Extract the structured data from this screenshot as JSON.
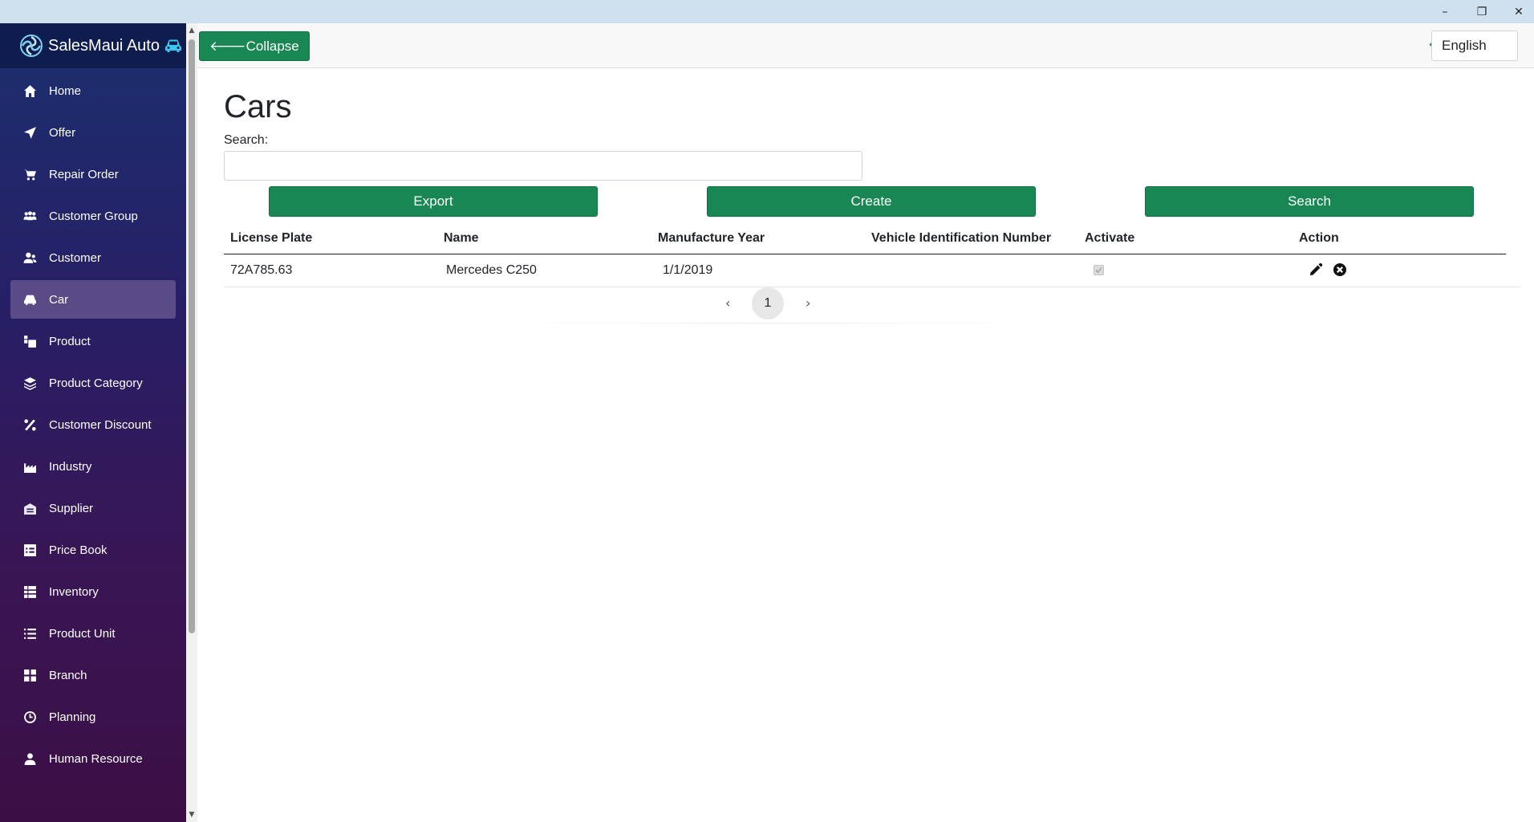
{
  "app": {
    "brand": "SalesMaui Auto"
  },
  "window_controls": {
    "minimize": "–",
    "restore": "❐",
    "close": "✕"
  },
  "sidebar": {
    "items": [
      {
        "label": "Home",
        "icon": "home-icon"
      },
      {
        "label": "Offer",
        "icon": "paper-plane-icon"
      },
      {
        "label": "Repair Order",
        "icon": "cart-icon"
      },
      {
        "label": "Customer Group",
        "icon": "users-icon"
      },
      {
        "label": "Customer",
        "icon": "user-group-icon"
      },
      {
        "label": "Car",
        "icon": "car-icon",
        "active": true
      },
      {
        "label": "Product",
        "icon": "product-icon"
      },
      {
        "label": "Product Category",
        "icon": "layers-icon"
      },
      {
        "label": "Customer Discount",
        "icon": "percent-icon"
      },
      {
        "label": "Industry",
        "icon": "industry-icon"
      },
      {
        "label": "Supplier",
        "icon": "warehouse-icon"
      },
      {
        "label": "Price Book",
        "icon": "table-icon"
      },
      {
        "label": "Inventory",
        "icon": "list-grid-icon"
      },
      {
        "label": "Product Unit",
        "icon": "list-icon"
      },
      {
        "label": "Branch",
        "icon": "grid-icon"
      },
      {
        "label": "Planning",
        "icon": "clock-icon"
      },
      {
        "label": "Human Resource",
        "icon": "user-icon"
      }
    ]
  },
  "topbar": {
    "collapse_label": "🡐Collapse",
    "language": "English"
  },
  "main": {
    "title": "Cars",
    "search_label": "Search:",
    "search_value": "",
    "buttons": {
      "export": "Export",
      "create": "Create",
      "search": "Search"
    },
    "columns": [
      "License Plate",
      "Name",
      "Manufacture Year",
      "Vehicle Identification Number",
      "Activate",
      "Action"
    ],
    "rows": [
      {
        "license_plate": "72A785.63",
        "name": "Mercedes C250",
        "manufacture_year": "1/1/2019",
        "vin": "",
        "activate": true
      }
    ],
    "pager": {
      "prev": "‹",
      "current": "1",
      "next": "›"
    }
  },
  "colors": {
    "accent_green": "#198754",
    "sidebar_top": "#1b2f6e",
    "sidebar_bottom": "#3b0f45",
    "active_item": "#5a4a86"
  }
}
